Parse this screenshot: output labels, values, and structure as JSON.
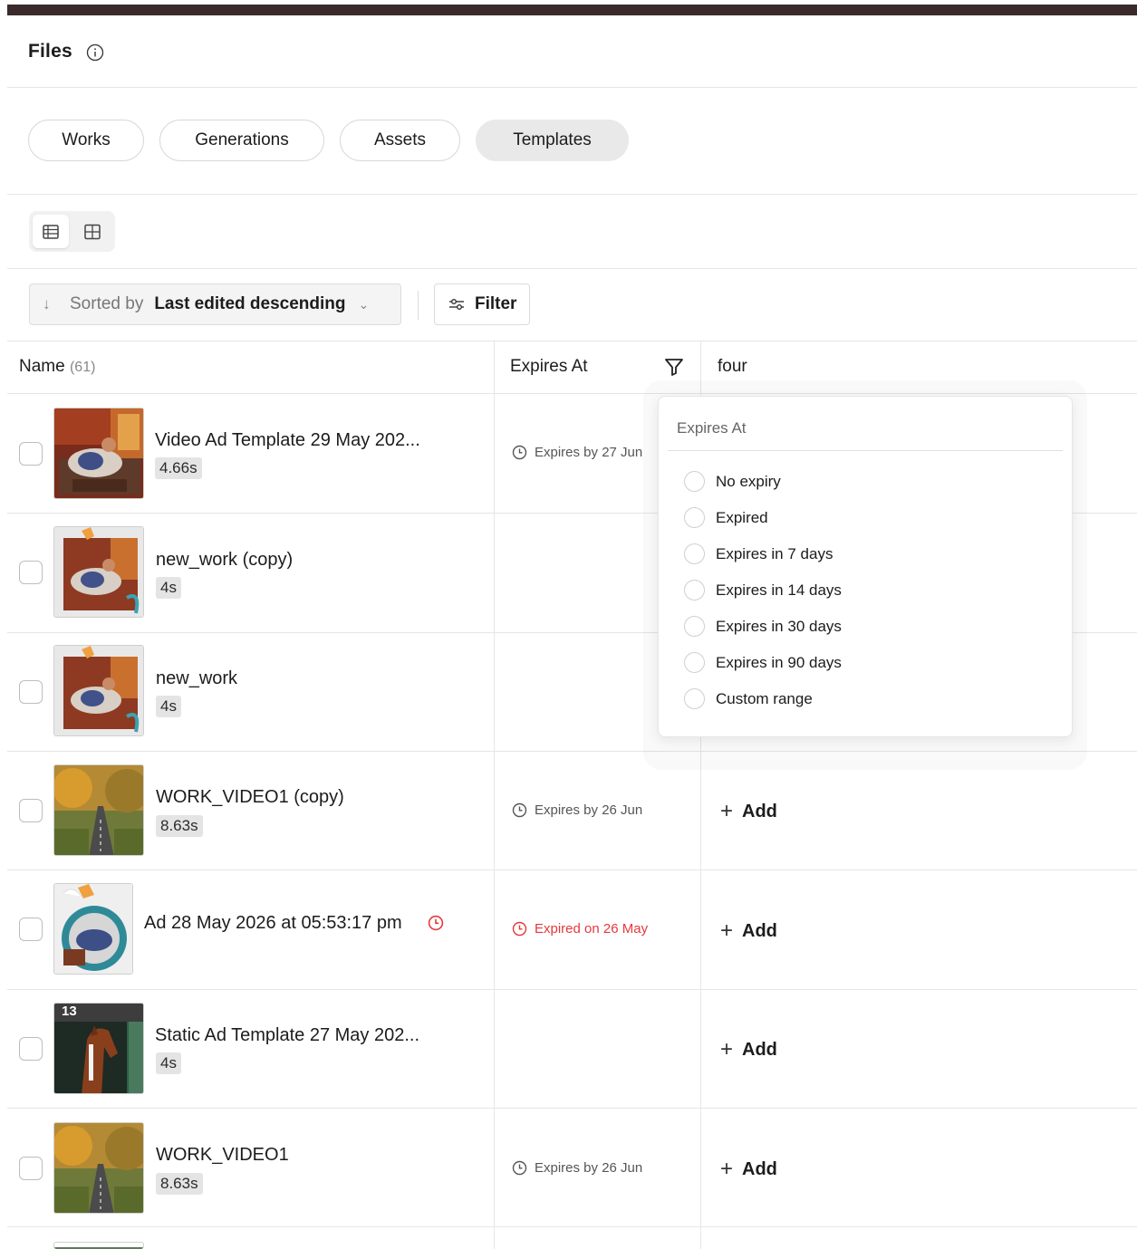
{
  "header": {
    "title": "Files"
  },
  "tabs": [
    {
      "label": "Works",
      "active": false
    },
    {
      "label": "Generations",
      "active": false
    },
    {
      "label": "Assets",
      "active": false
    },
    {
      "label": "Templates",
      "active": true
    }
  ],
  "view": {
    "modes": [
      "list-view-icon",
      "grid-view-icon"
    ],
    "active": "list"
  },
  "sort": {
    "label": "Sorted by",
    "value": "Last edited descending"
  },
  "filter": {
    "label": "Filter"
  },
  "table": {
    "columns": {
      "name": "Name",
      "name_count": "(61)",
      "expires": "Expires At",
      "four": "four"
    },
    "rows": [
      {
        "name": "Video Ad Template 29 May 202...",
        "duration": "4.66s",
        "expires": "Expires by 27 Jun",
        "expired": false,
        "add": ""
      },
      {
        "name": "new_work (copy)",
        "duration": "4s",
        "expires": "",
        "expired": false,
        "add": ""
      },
      {
        "name": "new_work",
        "duration": "4s",
        "expires": "",
        "expired": false,
        "add": ""
      },
      {
        "name": "WORK_VIDEO1 (copy)",
        "duration": "8.63s",
        "expires": "Expires by 26 Jun",
        "expired": false,
        "add": "Add"
      },
      {
        "name": "Ad 28 May 2026 at 05:53:17 pm",
        "duration": "",
        "expires": "Expired on 26 May",
        "expired": true,
        "add": "Add"
      },
      {
        "name": "Static Ad Template 27 May 202...",
        "duration": "4s",
        "expires": "",
        "expired": false,
        "add": "Add"
      },
      {
        "name": "WORK_VIDEO1",
        "duration": "8.63s",
        "expires": "Expires by 26 Jun",
        "expired": false,
        "add": "Add"
      }
    ]
  },
  "dropdown": {
    "title": "Expires At",
    "options": [
      "No expiry",
      "Expired",
      "Expires in 7 days",
      "Expires in 14 days",
      "Expires in 30 days",
      "Expires in 90 days",
      "Custom range"
    ]
  },
  "thumb_badge": "13",
  "colors": {
    "topbar": "#3a2a2c",
    "expired_red": "#e5383b",
    "active_tab": "#e9e9e9"
  }
}
